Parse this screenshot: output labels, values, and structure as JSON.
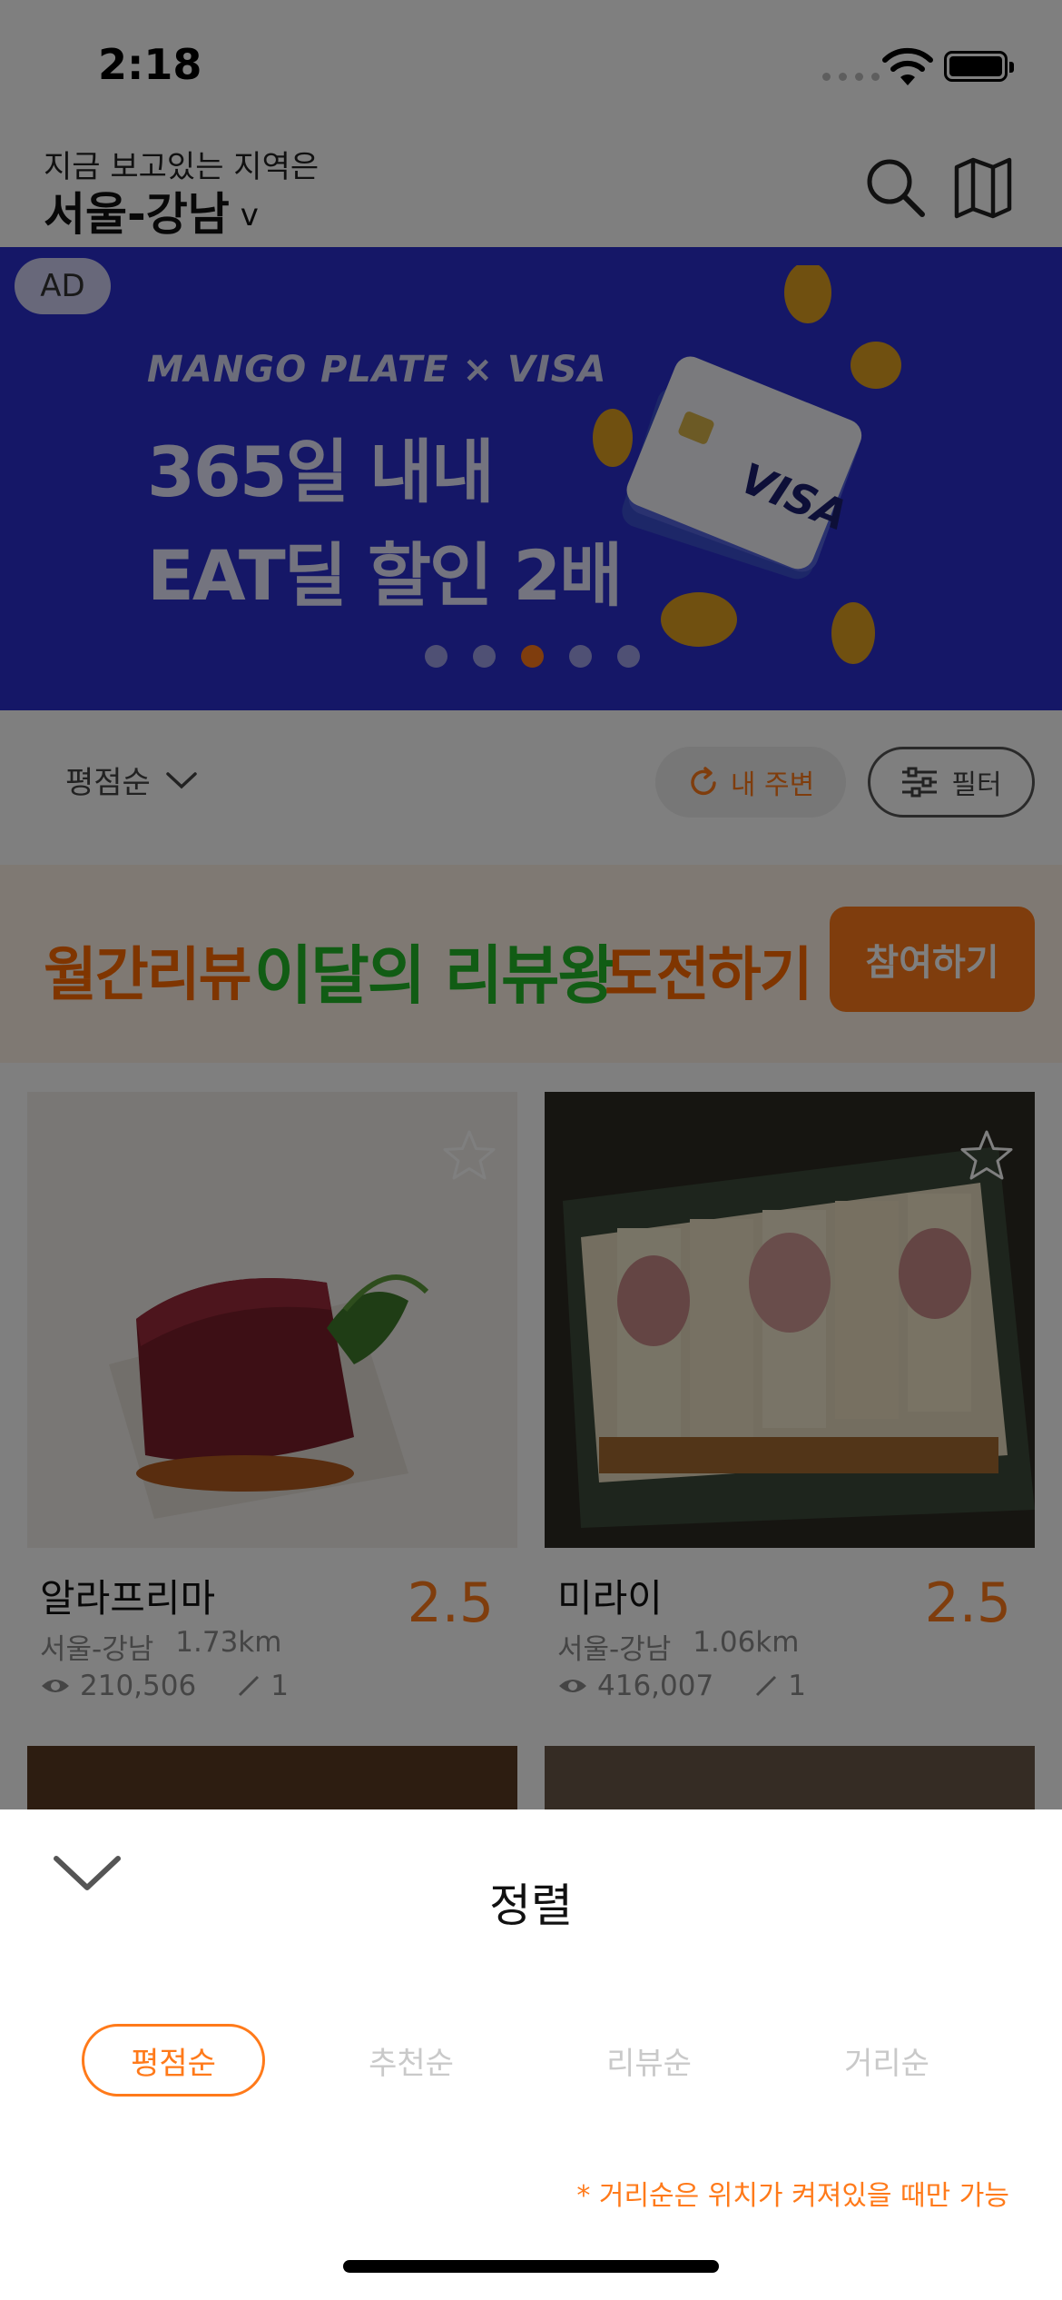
{
  "status_bar": {
    "time": "2:18"
  },
  "header": {
    "region_caption": "지금 보고있는 지역은",
    "region_name": "서울-강남",
    "region_chevron": "v"
  },
  "ad_banner": {
    "badge": "AD",
    "brand": "MANGO PLATE × VISA",
    "line1": "365일 내내",
    "line2": "EAT딜 할인 2배",
    "card_text": "VISA",
    "page_count": 5,
    "active_page": 3,
    "accent_color": "#ff7a1a"
  },
  "sort_bar": {
    "sort_label": "평점순",
    "nearby_label": "내 주변",
    "filter_label": "필터"
  },
  "promo": {
    "part1": "월간리뷰",
    "part2": "이달의 리뷰왕",
    "part3": "도전하기",
    "button": "참여하기"
  },
  "restaurants": [
    {
      "name": "알라프리마",
      "score": "2.5",
      "region": "서울-강남",
      "distance": "1.73km",
      "views": "210,506",
      "reviews": "1"
    },
    {
      "name": "미라이",
      "score": "2.5",
      "region": "서울-강남",
      "distance": "1.06km",
      "views": "416,007",
      "reviews": "1"
    }
  ],
  "sort_sheet": {
    "title": "정렬",
    "options": [
      "평점순",
      "추천순",
      "리뷰순",
      "거리순"
    ],
    "selected": "평점순",
    "note": "* 거리순은 위치가 켜져있을 때만 가능"
  },
  "colors": {
    "accent": "#ff7a1a",
    "banner_blue": "#2b2fcf",
    "promo_green": "#22b829"
  }
}
